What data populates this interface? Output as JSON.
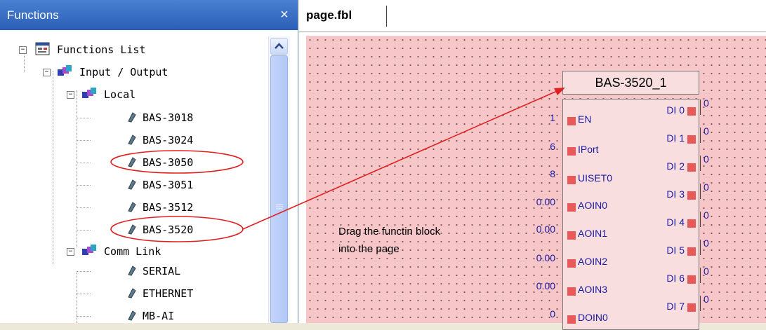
{
  "panel": {
    "title": "Functions",
    "close_glyph": "×",
    "tree": {
      "root": "Functions List",
      "io": "Input / Output",
      "local": "Local",
      "local_items": [
        "BAS-3018",
        "BAS-3024",
        "BAS-3050",
        "BAS-3051",
        "BAS-3512",
        "BAS-3520"
      ],
      "comm": "Comm Link",
      "comm_items": [
        "SERIAL",
        "ETHERNET",
        "MB-AI"
      ]
    }
  },
  "editor": {
    "tab": "page.fbl",
    "note_line1": "Drag the functin block",
    "note_line2": "into the page",
    "block": {
      "title": "BAS-3520_1",
      "inputs": [
        {
          "value": "1",
          "label": "EN"
        },
        {
          "value": "6",
          "label": "IPort"
        },
        {
          "value": "8",
          "label": "UISET0"
        },
        {
          "value": "0.00",
          "label": "AOIN0"
        },
        {
          "value": "0.00",
          "label": "AOIN1"
        },
        {
          "value": "0.00",
          "label": "AOIN2"
        },
        {
          "value": "0.00",
          "label": "AOIN3"
        },
        {
          "value": "0",
          "label": "DOIN0"
        }
      ],
      "outputs": [
        {
          "label": "DI 0",
          "value": "0"
        },
        {
          "label": "DI 1",
          "value": "0"
        },
        {
          "label": "DI 2",
          "value": "0"
        },
        {
          "label": "DI 3",
          "value": "0"
        },
        {
          "label": "DI 4",
          "value": "0"
        },
        {
          "label": "DI 5",
          "value": "0"
        },
        {
          "label": "DI 6",
          "value": "0"
        },
        {
          "label": "DI 7",
          "value": "0"
        }
      ]
    }
  },
  "colors": {
    "canvas": "#f6c6c9",
    "annotation": "#e02020",
    "pin": "#e85a5a",
    "title_bar": "#2a5fb8"
  }
}
